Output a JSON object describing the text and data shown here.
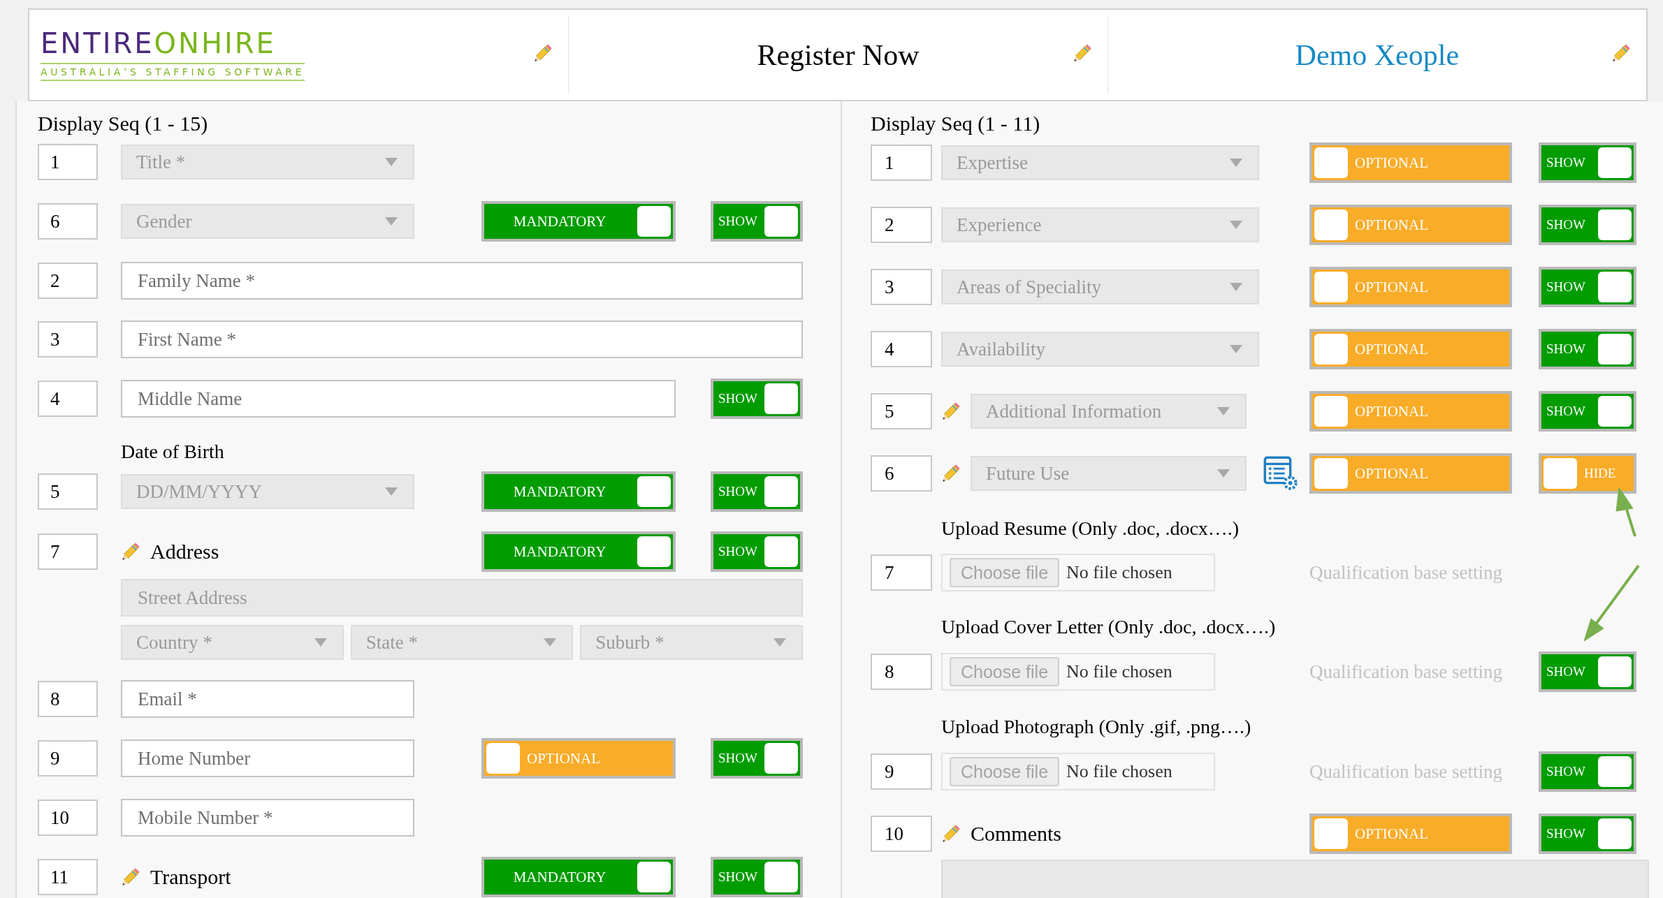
{
  "header": {
    "logo": {
      "primary": "ENTIRE",
      "secondary": "ONHIRE",
      "tagline": "AUSTRALIA’S STAFFING SOFTWARE"
    },
    "titles": [
      {
        "text": "Register Now",
        "kind": "plain"
      },
      {
        "text": "Demo Xeople",
        "kind": "link"
      }
    ]
  },
  "left": {
    "heading": "Display Seq (1 - 15)",
    "rows": [
      {
        "seq": "1",
        "kind": "select",
        "placeholder": "Title *"
      },
      {
        "seq": "6",
        "kind": "select",
        "placeholder": "Gender",
        "requirement": {
          "label": "MANDATORY",
          "on": true
        },
        "visibility": {
          "label": "SHOW",
          "on": true
        }
      },
      {
        "seq": "2",
        "kind": "input",
        "placeholder": "Family Name *"
      },
      {
        "seq": "3",
        "kind": "input",
        "placeholder": "First Name *"
      },
      {
        "seq": "4",
        "kind": "input",
        "placeholder": "Middle Name",
        "visibility": {
          "label": "SHOW",
          "on": true
        }
      },
      {
        "seq": "5",
        "kind": "select",
        "caption": "Date of Birth",
        "placeholder": "DD/MM/YYYY",
        "requirement": {
          "label": "MANDATORY",
          "on": true
        },
        "visibility": {
          "label": "SHOW",
          "on": true
        }
      },
      {
        "seq": "7",
        "kind": "address",
        "label": "Address",
        "street": "Street Address",
        "selects": [
          "Country *",
          "State *",
          "Suburb *"
        ],
        "requirement": {
          "label": "MANDATORY",
          "on": true
        },
        "visibility": {
          "label": "SHOW",
          "on": true
        }
      },
      {
        "seq": "8",
        "kind": "input",
        "placeholder": "Email *"
      },
      {
        "seq": "9",
        "kind": "input",
        "placeholder": "Home Number",
        "requirement": {
          "label": "OPTIONAL",
          "on": false
        },
        "visibility": {
          "label": "SHOW",
          "on": true
        }
      },
      {
        "seq": "10",
        "kind": "input",
        "placeholder": "Mobile Number *"
      },
      {
        "seq": "11",
        "kind": "heading",
        "label": "Transport",
        "requirement": {
          "label": "MANDATORY",
          "on": true
        },
        "visibility": {
          "label": "SHOW",
          "on": true
        }
      }
    ]
  },
  "right": {
    "heading": "Display Seq (1 - 11)",
    "rows": [
      {
        "seq": "1",
        "kind": "select",
        "placeholder": "Expertise",
        "requirement": {
          "label": "OPTIONAL",
          "on": false
        },
        "visibility": {
          "label": "SHOW",
          "on": true
        }
      },
      {
        "seq": "2",
        "kind": "select",
        "placeholder": "Experience",
        "requirement": {
          "label": "OPTIONAL",
          "on": false
        },
        "visibility": {
          "label": "SHOW",
          "on": true
        }
      },
      {
        "seq": "3",
        "kind": "select",
        "placeholder": "Areas of Speciality",
        "requirement": {
          "label": "OPTIONAL",
          "on": false
        },
        "visibility": {
          "label": "SHOW",
          "on": true
        }
      },
      {
        "seq": "4",
        "kind": "select",
        "placeholder": "Availability",
        "requirement": {
          "label": "OPTIONAL",
          "on": false
        },
        "visibility": {
          "label": "SHOW",
          "on": true
        }
      },
      {
        "seq": "5",
        "kind": "custom-select",
        "placeholder": "Additional Information",
        "requirement": {
          "label": "OPTIONAL",
          "on": false
        },
        "visibility": {
          "label": "SHOW",
          "on": true
        }
      },
      {
        "seq": "6",
        "kind": "custom-select",
        "placeholder": "Future Use",
        "settings": true,
        "requirement": {
          "label": "OPTIONAL",
          "on": false
        },
        "visibility": {
          "label": "HIDE",
          "on": false
        }
      },
      {
        "seq": "7",
        "kind": "upload",
        "caption": "Upload Resume (Only .doc, .docx….)",
        "button": "Choose file",
        "status": "No file chosen",
        "note": "Qualification base setting"
      },
      {
        "seq": "8",
        "kind": "upload",
        "caption": "Upload Cover Letter (Only .doc, .docx….)",
        "button": "Choose file",
        "status": "No file chosen",
        "note": "Qualification base setting",
        "visibility": {
          "label": "SHOW",
          "on": true
        }
      },
      {
        "seq": "9",
        "kind": "upload",
        "caption": "Upload Photograph (Only .gif, .png….)",
        "button": "Choose file",
        "status": "No file chosen",
        "note": "Qualification base setting",
        "visibility": {
          "label": "SHOW",
          "on": true
        }
      },
      {
        "seq": "10",
        "kind": "textarea",
        "label": "Comments",
        "requirement": {
          "label": "OPTIONAL",
          "on": false
        },
        "visibility": {
          "label": "SHOW",
          "on": true
        }
      }
    ]
  }
}
